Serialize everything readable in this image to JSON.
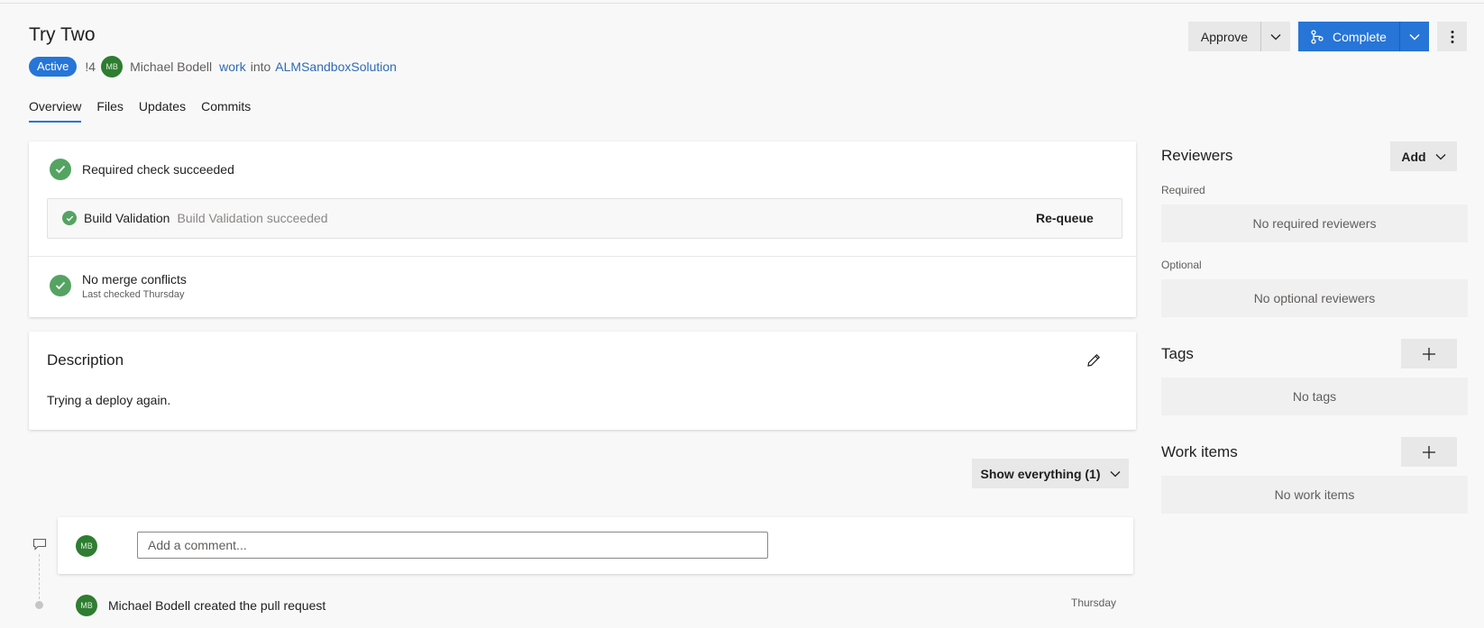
{
  "pr": {
    "title": "Try Two",
    "status": "Active",
    "id": "!4",
    "author_initials": "MB",
    "author": "Michael Bodell",
    "source_branch": "work",
    "into": "into",
    "target_branch": "ALMSandboxSolution"
  },
  "actions": {
    "approve": "Approve",
    "complete": "Complete"
  },
  "tabs": [
    "Overview",
    "Files",
    "Updates",
    "Commits"
  ],
  "checks": {
    "required_title": "Required check succeeded",
    "build_name": "Build Validation",
    "build_status": "Build Validation succeeded",
    "requeue": "Re-queue",
    "merge_title": "No merge conflicts",
    "merge_sub": "Last checked Thursday"
  },
  "description": {
    "heading": "Description",
    "text": "Trying a deploy again."
  },
  "filter": {
    "label": "Show everything (1)"
  },
  "comment": {
    "initials": "MB",
    "placeholder": "Add a comment..."
  },
  "timeline": {
    "initials": "MB",
    "text": "Michael Bodell created the pull request",
    "time": "Thursday"
  },
  "sidebar": {
    "reviewers_heading": "Reviewers",
    "add_label": "Add",
    "required_label": "Required",
    "no_required": "No required reviewers",
    "optional_label": "Optional",
    "no_optional": "No optional reviewers",
    "tags_heading": "Tags",
    "no_tags": "No tags",
    "work_items_heading": "Work items",
    "no_work_items": "No work items"
  },
  "colors": {
    "accent": "#2675d7",
    "success": "#55a362",
    "avatar": "#2e7d32"
  },
  "icons": [
    "chevron-down-icon",
    "branch-merge-icon",
    "more-vertical-icon",
    "check-icon",
    "pencil-icon",
    "plus-icon",
    "comment-icon"
  ]
}
